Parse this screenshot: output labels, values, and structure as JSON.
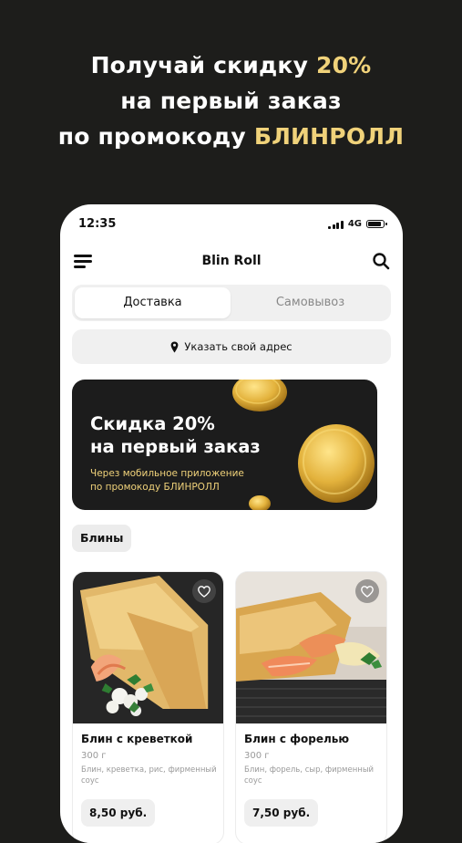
{
  "promo": {
    "line1_text": "Получай скидку ",
    "line1_accent": "20%",
    "line2": "на первый заказ",
    "line3_text": "по промокоду ",
    "line3_accent": "БЛИНРОЛЛ",
    "accent_color": "#f0d27a"
  },
  "status_bar": {
    "time": "12:35",
    "network": "4G"
  },
  "header": {
    "title": "Blin Roll",
    "menu_icon": "hamburger-menu-icon",
    "search_icon": "search-icon"
  },
  "delivery_toggle": {
    "options": [
      "Доставка",
      "Самовывоз"
    ],
    "selected": "Доставка"
  },
  "address_button": {
    "label": "Указать свой адрес",
    "icon": "location-pin-icon"
  },
  "banner": {
    "title_line1": "Скидка 20%",
    "title_line2": "на первый заказ",
    "subtitle_line1": "Через мобильное приложение",
    "subtitle_line2": "по промокоду БЛИНРОЛЛ"
  },
  "category": {
    "label": "Блины"
  },
  "products": [
    {
      "name": "Блин с креветкой",
      "weight": "300 г",
      "description": "Блин, креветка, рис, фирменный соус",
      "price": "8,50 руб."
    },
    {
      "name": "Блин с форелью",
      "weight": "300 г",
      "description": "Блин, форель, сыр, фирменный соус",
      "price": "7,50 руб."
    }
  ]
}
